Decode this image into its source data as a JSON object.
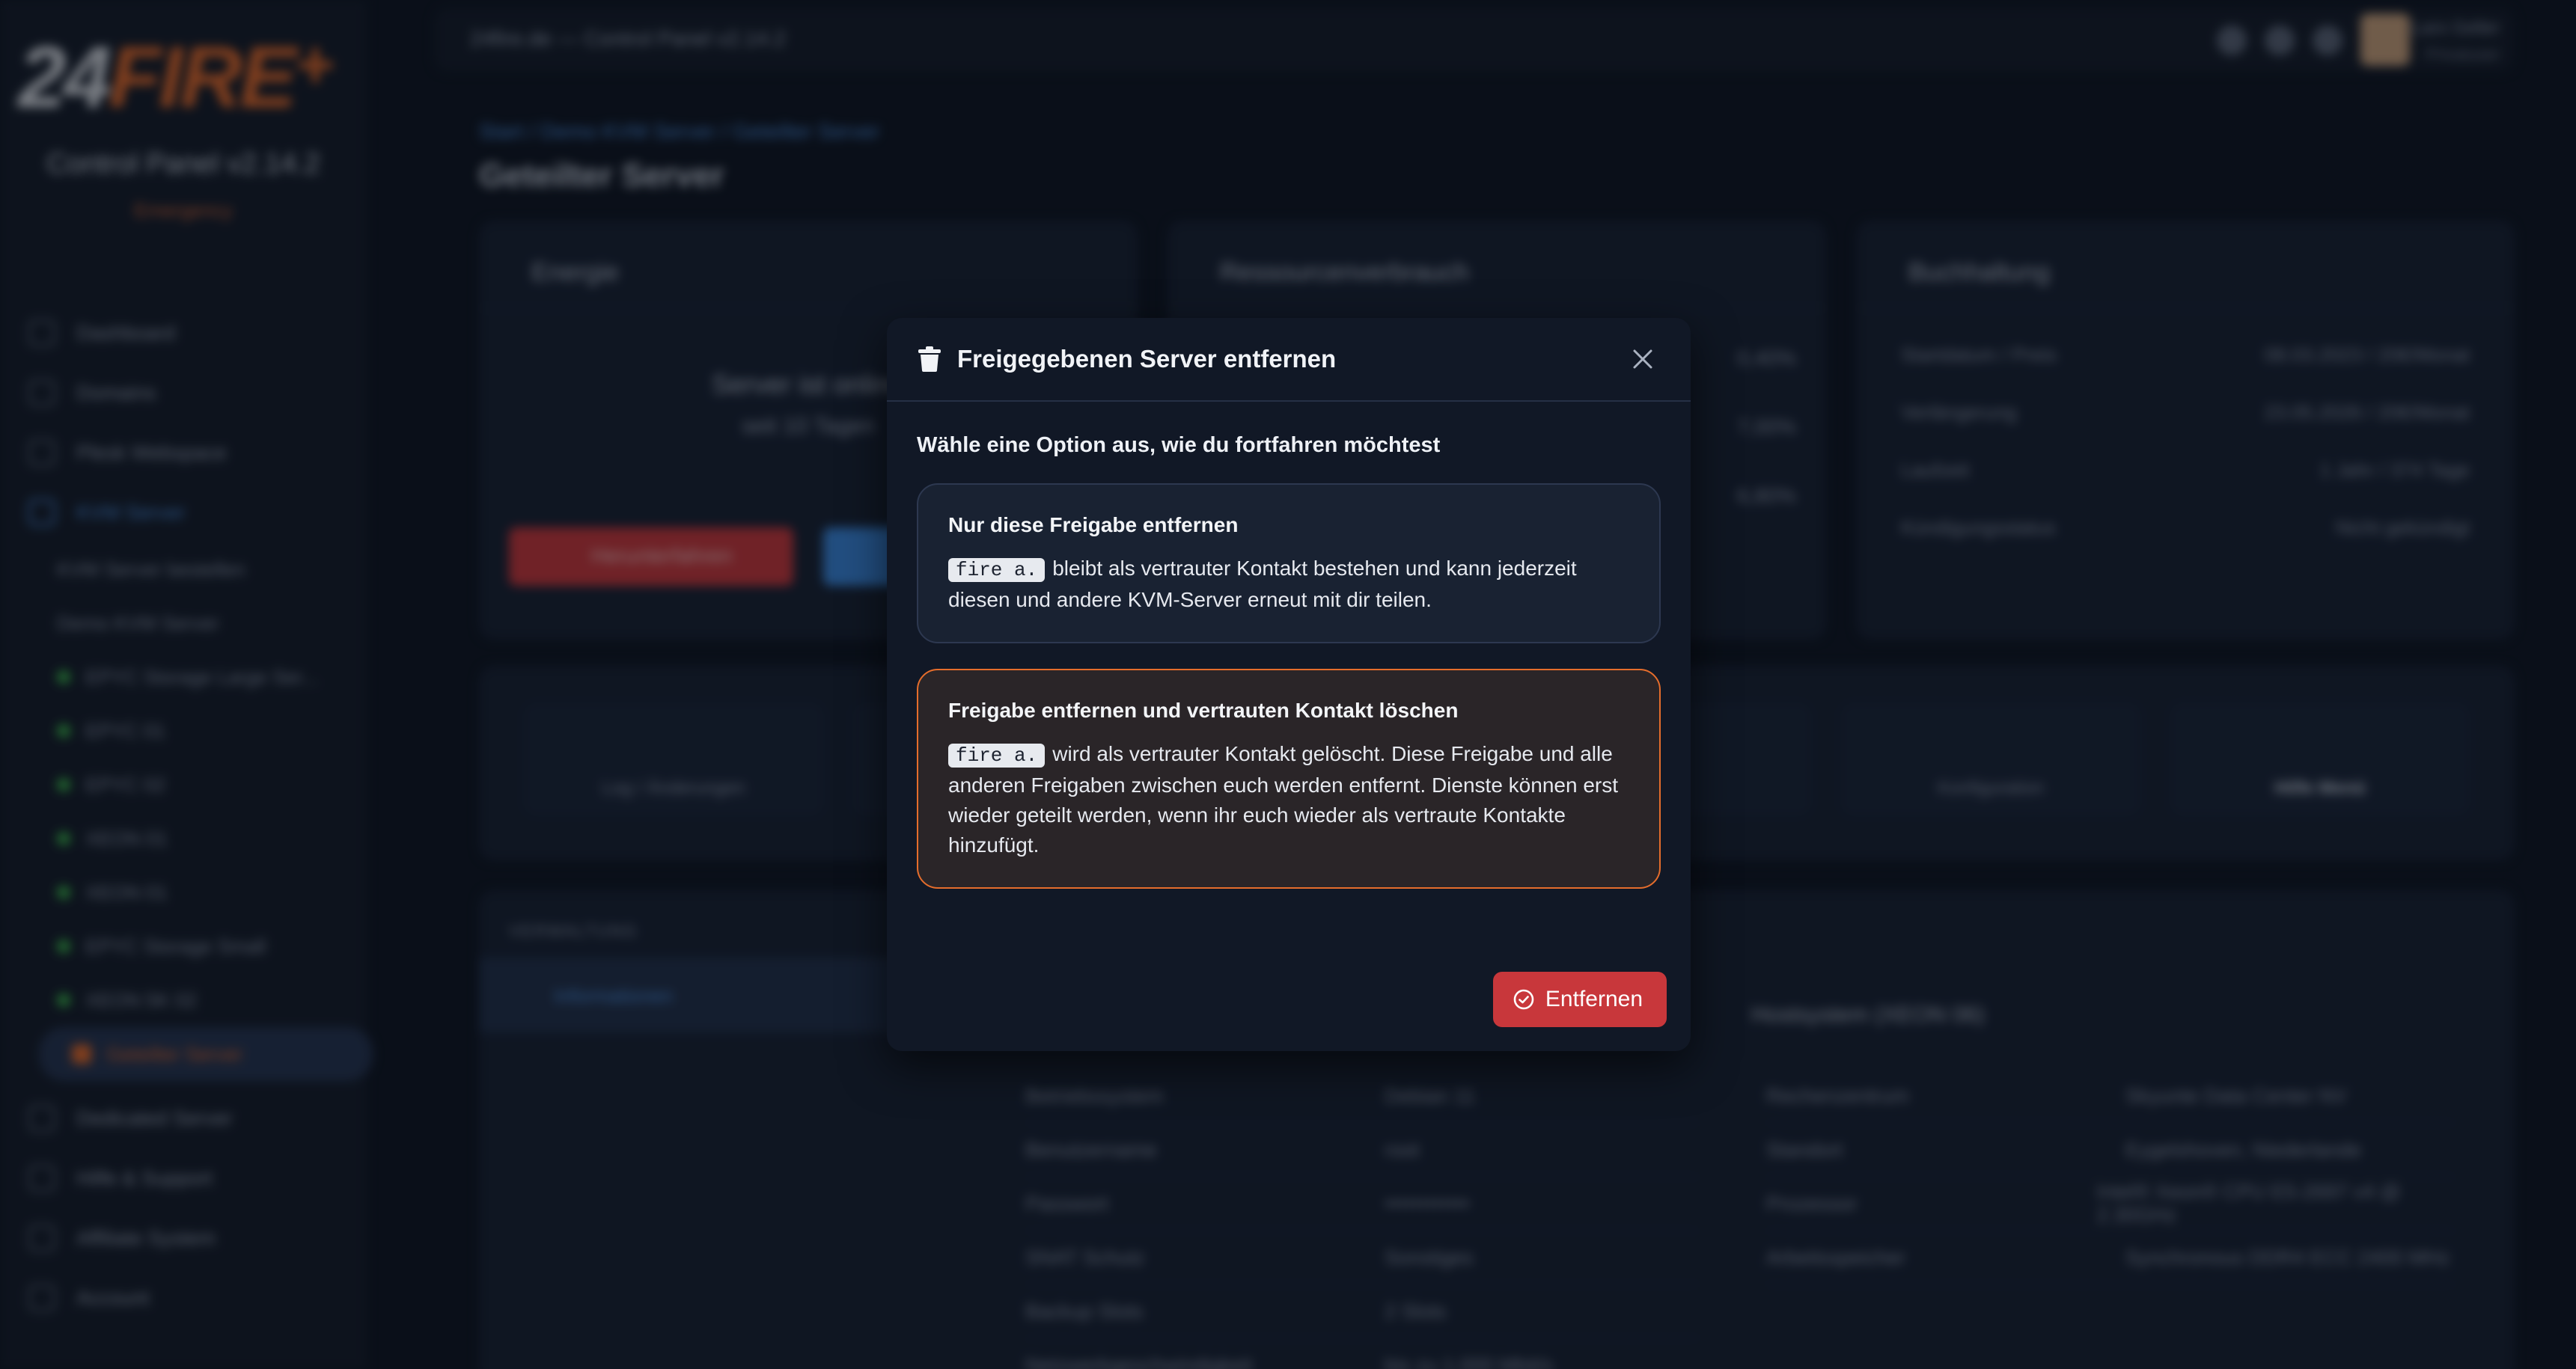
{
  "app": {
    "logo_main": "24",
    "logo_flame": "FIRE",
    "logo_plus": "+",
    "title": "Control Panel v2.14.2",
    "status": "Emergency"
  },
  "topbar": {
    "title": "24fire.de — Control Panel v2.14.2",
    "user_name": "Lars Geller",
    "user_role": "Privatuser"
  },
  "sidebar": {
    "items": [
      {
        "label": "Dashboard"
      },
      {
        "label": "Domains"
      },
      {
        "label": "Plesk Webspace"
      },
      {
        "label": "KVM Server"
      }
    ],
    "kvm_items": [
      {
        "label": "KVM Server bestellen"
      },
      {
        "label": "Demo KVM Server"
      },
      {
        "label": "EPYC Storage Large Ser..."
      },
      {
        "label": "EPYC 01"
      },
      {
        "label": "EPYC 02"
      },
      {
        "label": "XEON 01"
      },
      {
        "label": "XEON 01"
      },
      {
        "label": "EPYC Storage Small"
      },
      {
        "label": "XEON 5K 02"
      },
      {
        "label": "Geteilter Server"
      }
    ],
    "bottom_items": [
      {
        "label": "Dedicated Server"
      },
      {
        "label": "Hilfe & Support"
      },
      {
        "label": "Affiliate System"
      },
      {
        "label": "Account"
      }
    ]
  },
  "page": {
    "breadcrumb": "Start / Demo KVM Server / Geteilter Server",
    "title": "Geteilter Server"
  },
  "cards": {
    "energy": {
      "title": "Energie",
      "status": "Server ist online",
      "since": "seit 10 Tagen",
      "stop_label": "Herunterfahren"
    },
    "resources": {
      "title": "Ressourcenverbrauch",
      "cpu": "0,40%",
      "ram": "7,00%",
      "disk": "6,80%"
    },
    "booking": {
      "title": "Buchhaltung",
      "rows": [
        {
          "label": "Startdatum / Preis",
          "value": "08.03.2023 / 20€/Monat"
        },
        {
          "label": "Verlängerung",
          "value": "23.05.2026 / 20€/Monat"
        },
        {
          "label": "Laufzeit",
          "value": "1 Jahr / 374 Tage"
        },
        {
          "label": "Kündigungsstatus",
          "value": "Nicht gekündigt"
        }
      ]
    }
  },
  "tools": {
    "log_label": "Log / Änderungen",
    "config_label": "Konfiguration",
    "help_label": "Hilfe Menü"
  },
  "details": {
    "section": "VERWALTUNG",
    "tab": "Informationen",
    "rows": [
      {
        "label": "Betriebssystem",
        "value": "Debian 11"
      },
      {
        "label": "Benutzername",
        "value": "root"
      },
      {
        "label": "Passwort",
        "value": "••••••••••••"
      },
      {
        "label": "SNAT Schutz",
        "value": "Sonstiges"
      },
      {
        "label": "Backup Slots",
        "value": "2 Slots"
      },
      {
        "label": "Netzwerkgeschwindigkeit",
        "value": "bis zu 1.000 Mbit/s"
      }
    ],
    "host_title": "Hostsystem (XEON 06)",
    "host_rows": [
      {
        "label": "Rechenzentrum",
        "value": "Skyunte Data Center NV"
      },
      {
        "label": "Standort",
        "value": "Eygelshoven, Niederlande"
      },
      {
        "label": "Prozessor",
        "value": "Intel® Xeon® CPU E5-2697 v4 @ 2.30GHz"
      },
      {
        "label": "Arbeitsspeicher",
        "value": "Synchronous DDR4 ECC 2400 MHz"
      }
    ]
  },
  "modal": {
    "title": "Freigegebenen Server entfernen",
    "prompt": "Wähle eine Option aus, wie du fortfahren möchtest",
    "option1": {
      "title": "Nur diese Freigabe entfernen",
      "contact": "fire a.",
      "text": "bleibt als vertrauter Kontakt bestehen und kann jederzeit diesen und andere KVM-Server erneut mit dir teilen."
    },
    "option2": {
      "title": "Freigabe entfernen und vertrauten Kontakt löschen",
      "contact": "fire a.",
      "text": "wird als vertrauter Kontakt gelöscht. Diese Freigabe und alle anderen Freigaben zwischen euch werden entfernt. Dienste können erst wieder geteilt werden, wenn ihr euch wieder als vertraute Kontakte hinzufügt."
    },
    "confirm_label": "Entfernen"
  },
  "colors": {
    "accent": "#e56d2c",
    "danger": "#c8373b",
    "link": "#4c8fe0",
    "modal_bg": "#111826"
  }
}
